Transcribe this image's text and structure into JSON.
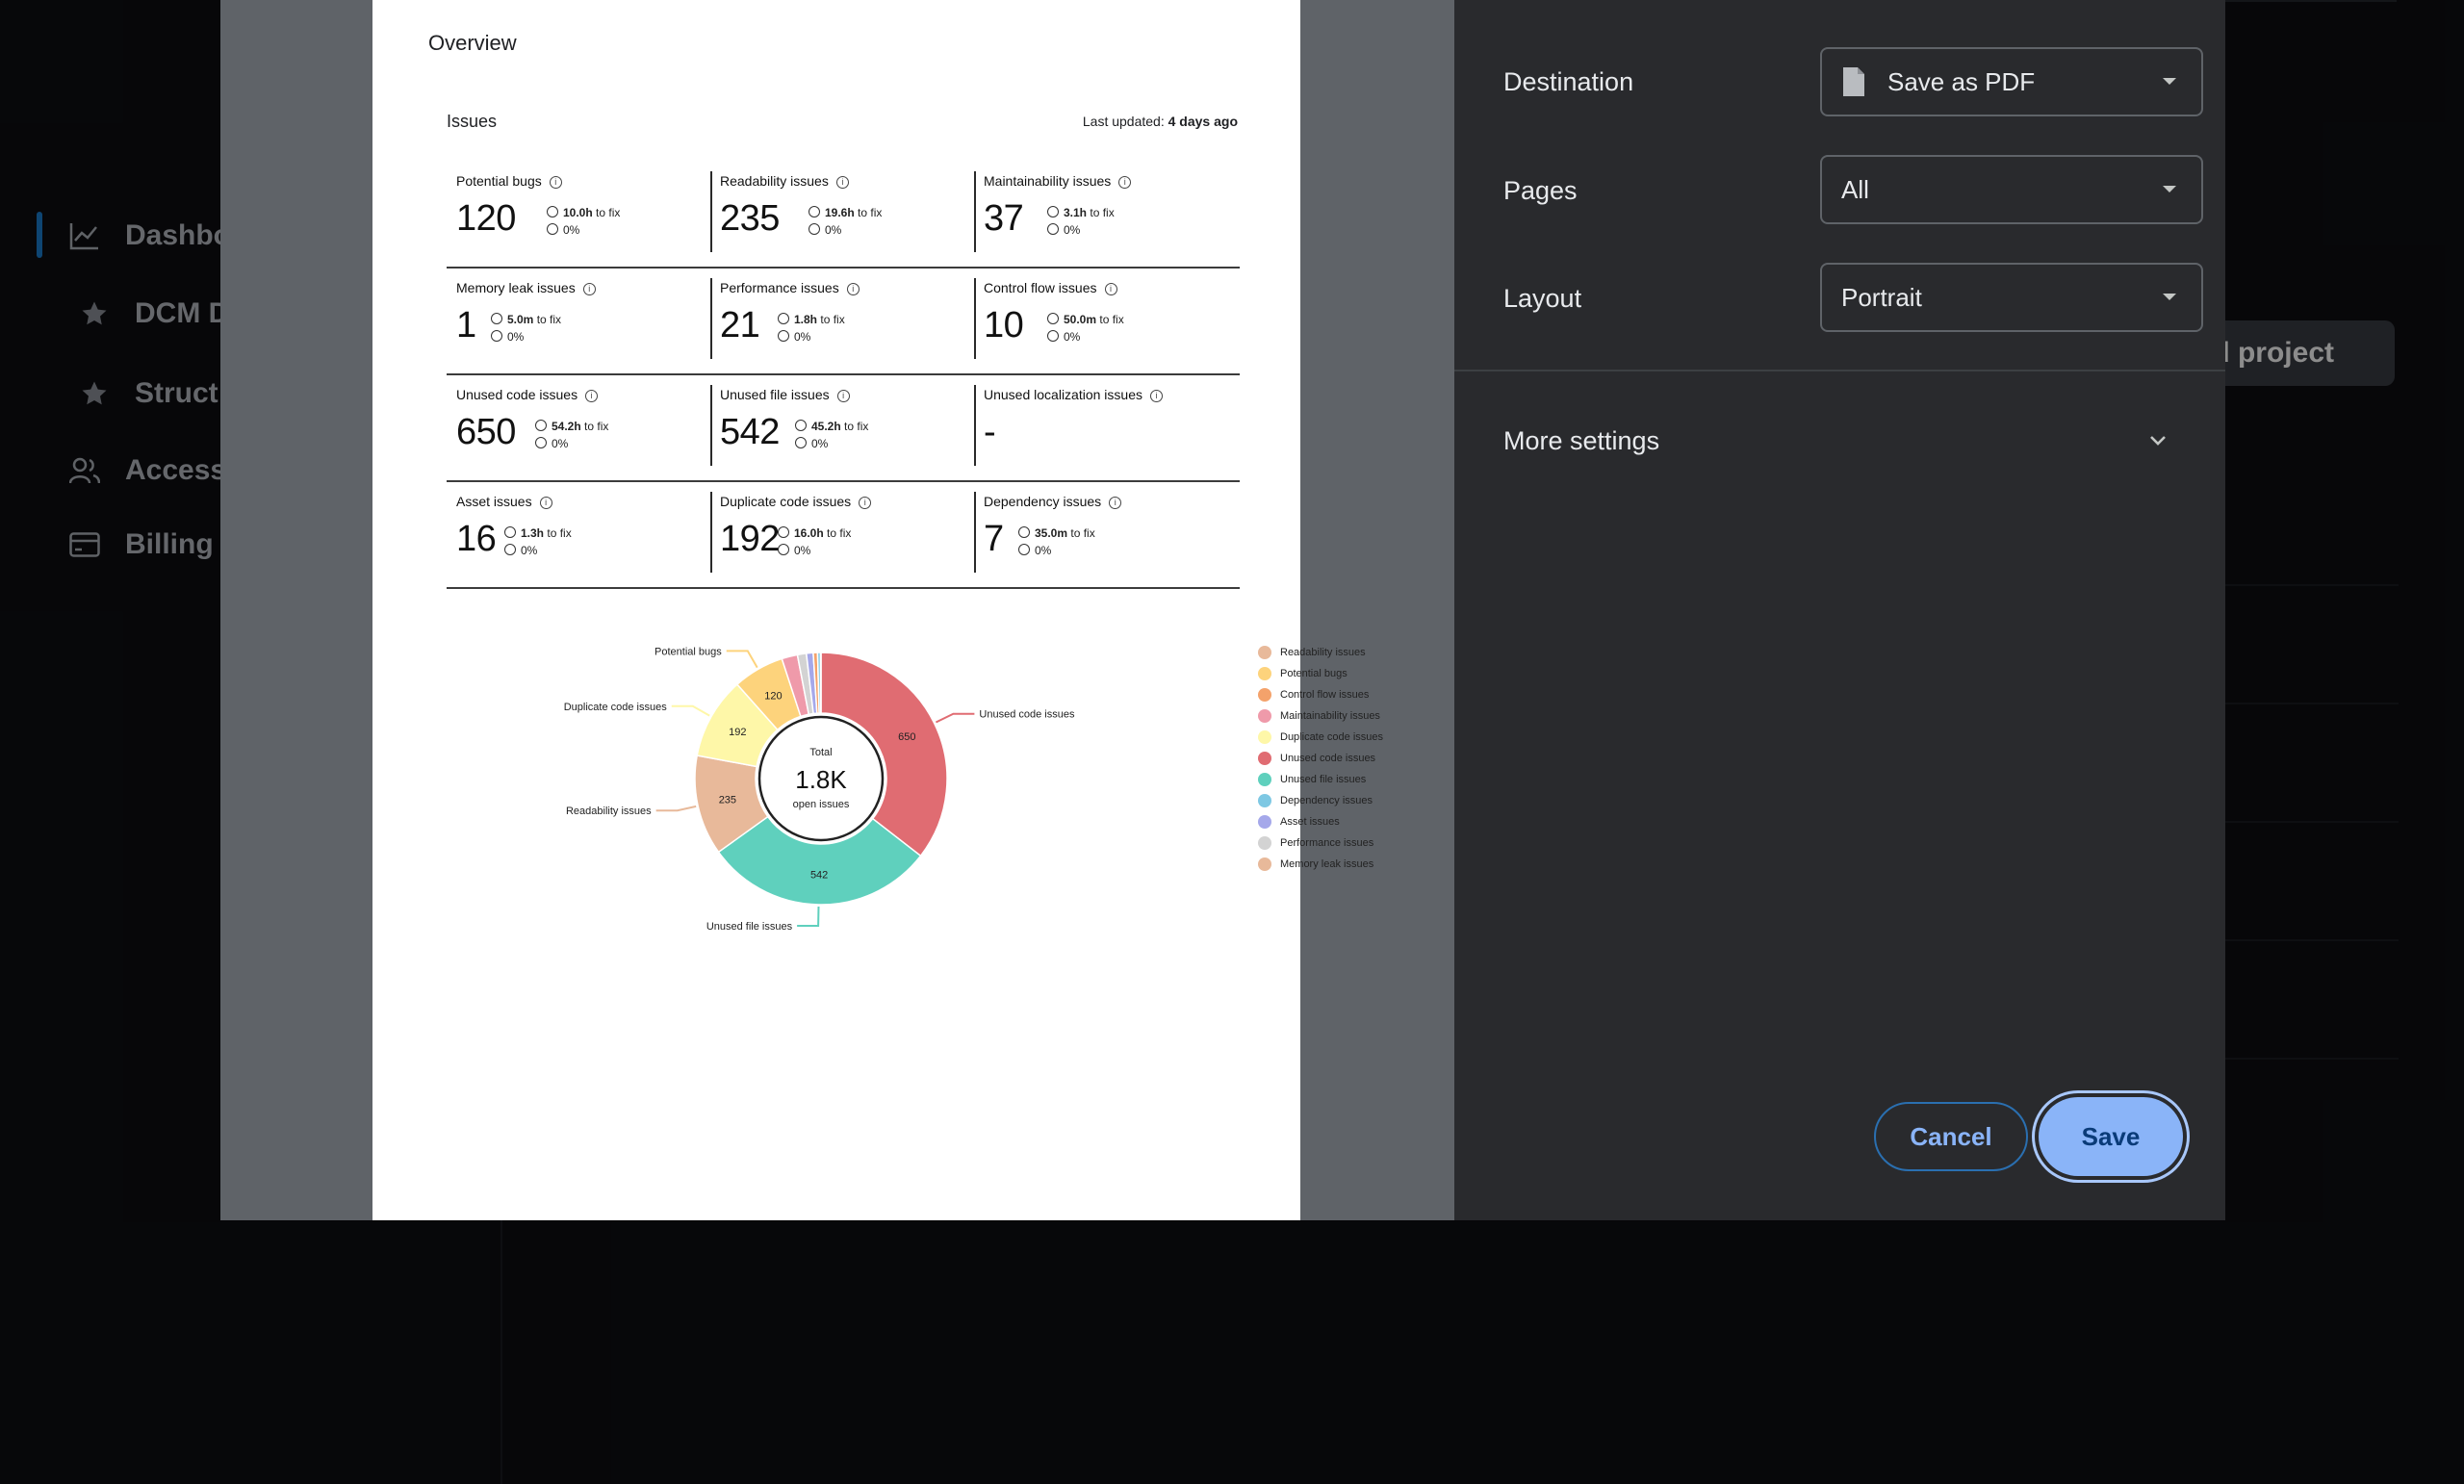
{
  "background": {
    "nav": [
      {
        "label": "Dashbo",
        "icon": "chart-line-icon"
      },
      {
        "label": "DCM D",
        "icon": "star-icon"
      },
      {
        "label": "Struct",
        "icon": "star-icon"
      },
      {
        "label": "Access",
        "icon": "users-icon"
      },
      {
        "label": "Billing",
        "icon": "credit-card-icon"
      }
    ],
    "add_project_label": "dd project"
  },
  "preview": {
    "overview_title": "Overview",
    "issues_title": "Issues",
    "last_updated_prefix": "Last updated:",
    "last_updated_value": "4 days ago",
    "metrics": [
      {
        "label": "Potential bugs",
        "value": "120",
        "fix": "10.0h",
        "fix_suffix": "to fix",
        "trend": "0%"
      },
      {
        "label": "Readability issues",
        "value": "235",
        "fix": "19.6h",
        "fix_suffix": "to fix",
        "trend": "0%"
      },
      {
        "label": "Maintainability issues",
        "value": "37",
        "fix": "3.1h",
        "fix_suffix": "to fix",
        "trend": "0%"
      },
      {
        "label": "Memory leak issues",
        "value": "1",
        "fix": "5.0m",
        "fix_suffix": "to fix",
        "trend": "0%"
      },
      {
        "label": "Performance issues",
        "value": "21",
        "fix": "1.8h",
        "fix_suffix": "to fix",
        "trend": "0%"
      },
      {
        "label": "Control flow issues",
        "value": "10",
        "fix": "50.0m",
        "fix_suffix": "to fix",
        "trend": "0%"
      },
      {
        "label": "Unused code issues",
        "value": "650",
        "fix": "54.2h",
        "fix_suffix": "to fix",
        "trend": "0%"
      },
      {
        "label": "Unused file issues",
        "value": "542",
        "fix": "45.2h",
        "fix_suffix": "to fix",
        "trend": "0%"
      },
      {
        "label": "Unused localization issues",
        "value": "-",
        "fix": "",
        "fix_suffix": "",
        "trend": ""
      },
      {
        "label": "Asset issues",
        "value": "16",
        "fix": "1.3h",
        "fix_suffix": "to fix",
        "trend": "0%"
      },
      {
        "label": "Duplicate code issues",
        "value": "192",
        "fix": "16.0h",
        "fix_suffix": "to fix",
        "trend": "0%"
      },
      {
        "label": "Dependency issues",
        "value": "7",
        "fix": "35.0m",
        "fix_suffix": "to fix",
        "trend": "0%"
      }
    ],
    "donut_center": {
      "top": "Total",
      "value": "1.8K",
      "bottom": "open issues"
    }
  },
  "chart_data": {
    "type": "pie",
    "title": "",
    "slices": [
      {
        "name": "Unused code issues",
        "value": 650,
        "color": "#e06c72",
        "label": "650",
        "callout": "Unused code issues"
      },
      {
        "name": "Unused file issues",
        "value": 542,
        "color": "#5fd0bd",
        "label": "542",
        "callout": "Unused file issues"
      },
      {
        "name": "Readability issues",
        "value": 235,
        "color": "#e8b99a",
        "label": "235",
        "callout": "Readability issues"
      },
      {
        "name": "Duplicate code issues",
        "value": 192,
        "color": "#fef7a8",
        "label": "192",
        "callout": "Duplicate code issues"
      },
      {
        "name": "Potential bugs",
        "value": 120,
        "color": "#fdd37c",
        "label": "120",
        "callout": "Potential bugs"
      },
      {
        "name": "Maintainability issues",
        "value": 37,
        "color": "#ef9aaa",
        "label": "",
        "callout": ""
      },
      {
        "name": "Performance issues",
        "value": 21,
        "color": "#d3d3d3",
        "label": "",
        "callout": ""
      },
      {
        "name": "Asset issues",
        "value": 16,
        "color": "#a5a8ea",
        "label": "",
        "callout": ""
      },
      {
        "name": "Control flow issues",
        "value": 10,
        "color": "#f4a26b",
        "label": "",
        "callout": ""
      },
      {
        "name": "Dependency issues",
        "value": 7,
        "color": "#7ec8e3",
        "label": "",
        "callout": ""
      },
      {
        "name": "Memory leak issues",
        "value": 1,
        "color": "#e8b99a",
        "label": "",
        "callout": ""
      }
    ],
    "legend": [
      {
        "name": "Readability issues",
        "color": "#e8b99a"
      },
      {
        "name": "Potential bugs",
        "color": "#fdd37c"
      },
      {
        "name": "Control flow issues",
        "color": "#f4a26b"
      },
      {
        "name": "Maintainability issues",
        "color": "#ef9aaa"
      },
      {
        "name": "Duplicate code issues",
        "color": "#fef7a8"
      },
      {
        "name": "Unused code issues",
        "color": "#e06c72"
      },
      {
        "name": "Unused file issues",
        "color": "#5fd0bd"
      },
      {
        "name": "Dependency issues",
        "color": "#7ec8e3"
      },
      {
        "name": "Asset issues",
        "color": "#a5a8ea"
      },
      {
        "name": "Performance issues",
        "color": "#d3d3d3"
      },
      {
        "name": "Memory leak issues",
        "color": "#e8b99a"
      }
    ],
    "legend_position": "right"
  },
  "settings": {
    "destination_label": "Destination",
    "destination_value": "Save as PDF",
    "pages_label": "Pages",
    "pages_value": "All",
    "layout_label": "Layout",
    "layout_value": "Portrait",
    "more_settings_label": "More settings",
    "cancel_label": "Cancel",
    "save_label": "Save"
  },
  "colors": {
    "dialog_bg": "#202124",
    "settings_bg": "#292a2d",
    "accent": "#8ab4f8",
    "nav_active": "#1a7fd0"
  }
}
